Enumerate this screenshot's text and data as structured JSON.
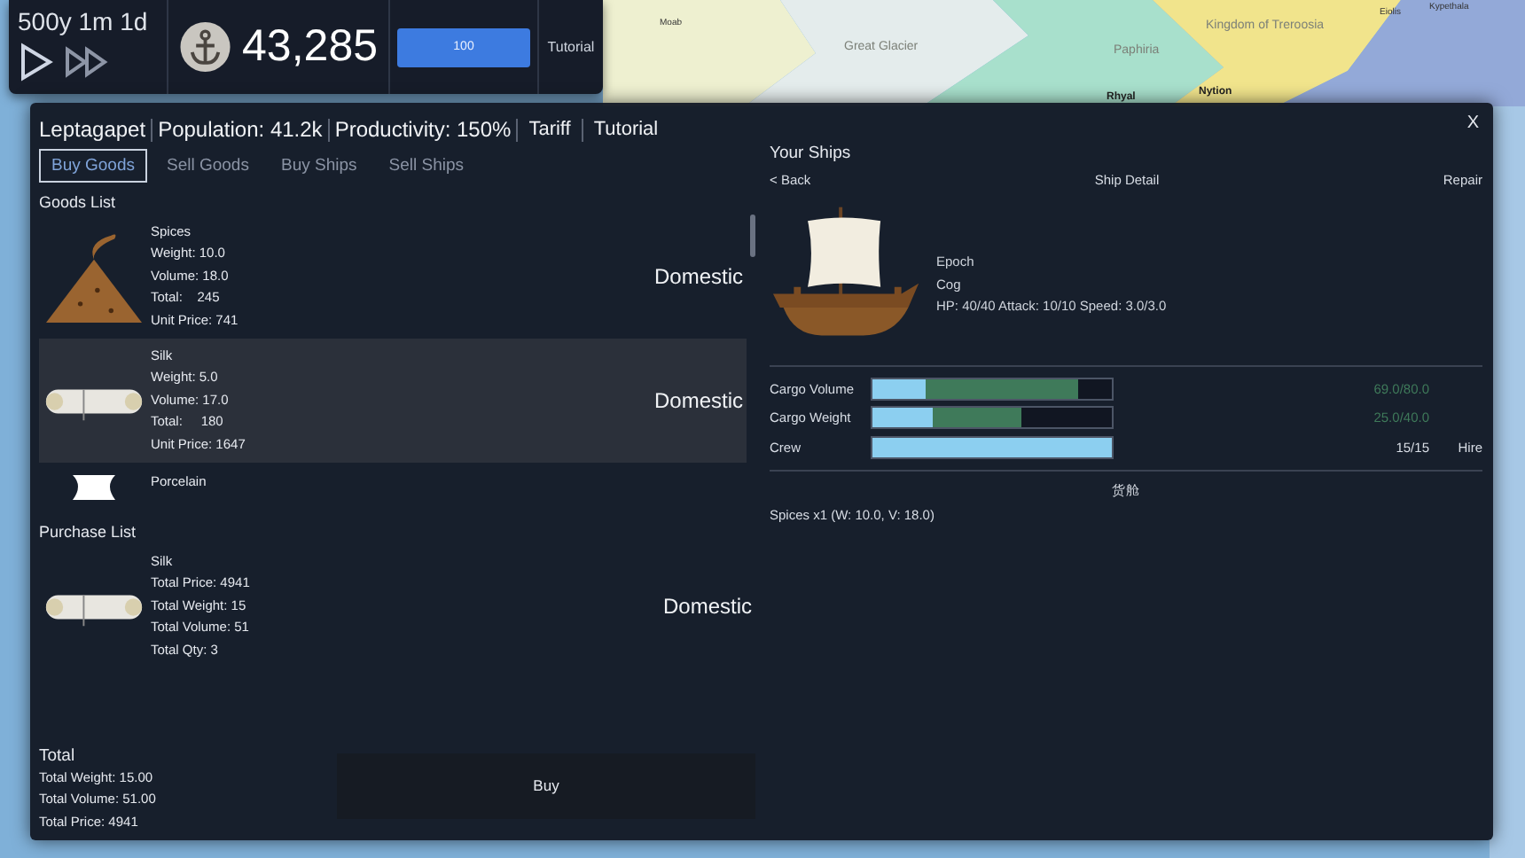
{
  "map": {
    "labels": [
      {
        "text": "Moab",
        "kind": "port"
      },
      {
        "text": "Great Glacier",
        "kind": "region"
      },
      {
        "text": "Paphiria",
        "kind": "region"
      },
      {
        "text": "Kingdom of Treroosia",
        "kind": "region"
      },
      {
        "text": "Rhyal",
        "kind": "city"
      },
      {
        "text": "Nytion",
        "kind": "city"
      },
      {
        "text": "Eiolis",
        "kind": "port"
      },
      {
        "text": "Kypethala",
        "kind": "port"
      }
    ]
  },
  "hud": {
    "date": "500y 1m 1d",
    "money": "43,285",
    "meter": {
      "label": "100",
      "level": 1
    },
    "tutorial": "Tutorial"
  },
  "city": {
    "name": "Leptagapet",
    "population": "Population: 41.2k",
    "productivity": "Productivity: 150%",
    "tariff": "Tariff",
    "tutorial": "Tutorial",
    "close": "X"
  },
  "tabs": [
    {
      "label": "Buy Goods",
      "selected": true
    },
    {
      "label": "Sell Goods",
      "selected": false
    },
    {
      "label": "Buy Ships",
      "selected": false
    },
    {
      "label": "Sell Ships",
      "selected": false
    }
  ],
  "goods_list": {
    "title": "Goods List",
    "items": [
      {
        "kind": "spices",
        "selected": false,
        "name": "Spices",
        "details": [
          "Weight: 10.0",
          "Volume: 18.0",
          "Total:    245",
          "Unit Price: 741"
        ],
        "origin": "Domestic"
      },
      {
        "kind": "silk",
        "selected": true,
        "name": "Silk",
        "details": [
          "Weight: 5.0",
          "Volume: 17.0",
          "Total:     180",
          "Unit Price: 1647"
        ],
        "origin": "Domestic"
      },
      {
        "kind": "porcelain",
        "selected": false,
        "name": "Porcelain"
      }
    ]
  },
  "purchase_list": {
    "title": "Purchase List",
    "items": [
      {
        "kind": "silk",
        "name": "Silk",
        "details": [
          "Total Price: 4941",
          "Total Weight: 15",
          "Total Volume: 51",
          "Total Qty: 3"
        ],
        "origin": "Domestic"
      }
    ]
  },
  "totals": {
    "title": "Total",
    "lines": [
      "Total Weight: 15.00",
      "Total Volume: 51.00",
      "Total Price: 4941"
    ],
    "buy": "Buy"
  },
  "ships": {
    "title": "Your Ships",
    "back": "< Back",
    "detail": "Ship Detail",
    "repair": "Repair",
    "name": "Epoch",
    "type": "Cog",
    "stats": "HP: 40/40 Attack: 10/10 Speed: 3.0/3.0",
    "bars": [
      {
        "label": "Cargo Volume",
        "segments": [
          {
            "kind": "loaded",
            "level": 0.225
          },
          {
            "kind": "pending",
            "level": 0.8625
          }
        ],
        "reading": "69.0/80.0"
      },
      {
        "label": "Cargo Weight",
        "segments": [
          {
            "kind": "loaded",
            "level": 0.25
          },
          {
            "kind": "pending",
            "level": 0.625
          }
        ],
        "reading": "25.0/40.0"
      },
      {
        "label": "Crew",
        "segments": [
          {
            "kind": "loaded",
            "level": 1
          }
        ],
        "reading": "15/15",
        "action": "Hire"
      }
    ],
    "hold_title": "货舱",
    "hold_items": [
      "Spices x1 (W: 10.0, V: 18.0)"
    ]
  }
}
